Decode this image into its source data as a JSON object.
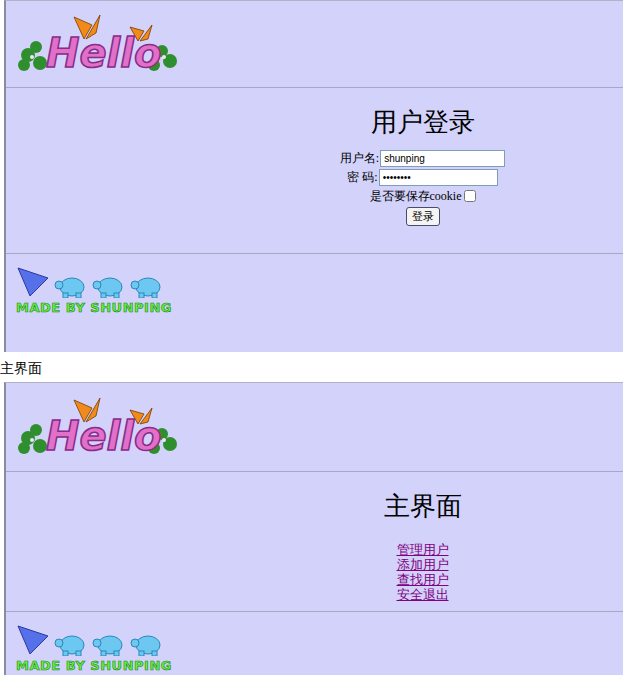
{
  "login_page": {
    "logo": "Hello",
    "title": "用户登录",
    "fields": [
      {
        "label": "用户名:",
        "value": "shunping",
        "kind": "text"
      },
      {
        "label": "密 码:",
        "value": "••••••••",
        "kind": "password"
      }
    ],
    "remember": {
      "label": "是否要保存cookie",
      "checked": false
    },
    "button": "登录",
    "footer": "MADE BY SHUNPING"
  },
  "caption": "主界面",
  "main_page": {
    "logo": "Hello",
    "title": "主界面",
    "links": [
      "管理用户",
      "添加用户",
      "查找用户",
      "安全退出"
    ],
    "footer": "MADE BY SHUNPING"
  }
}
